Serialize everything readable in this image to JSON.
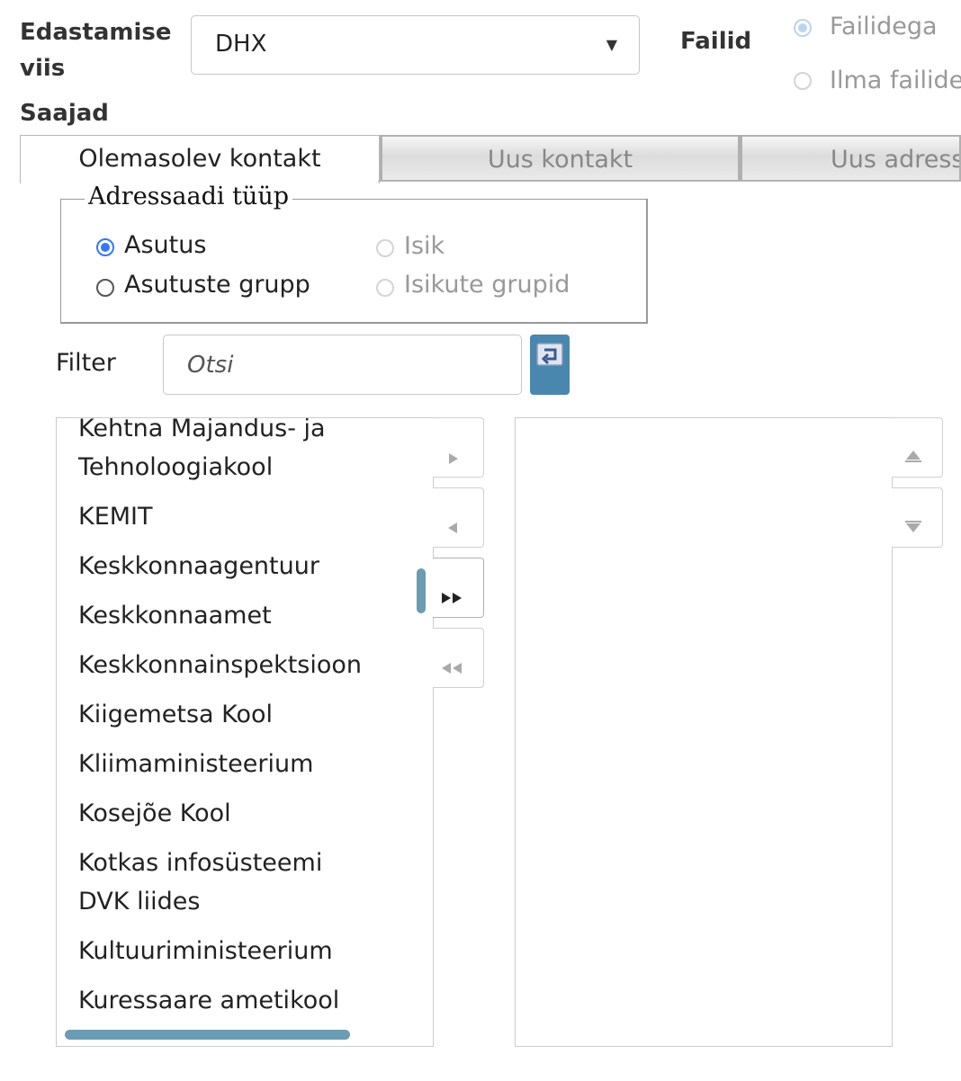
{
  "form": {
    "delivery_label_line1": "Edastamise",
    "delivery_label_line2": "viis",
    "delivery_value": "DHX",
    "files_label": "Failid",
    "file_options": [
      "Failidega",
      "Ilma failide"
    ],
    "recipients_label": "Saajad"
  },
  "tabs": [
    "Olemasolev kontakt",
    "Uus kontakt",
    "Uus adress"
  ],
  "addressee": {
    "legend": "Adressaadi tüüp",
    "options": [
      "Asutus",
      "Isik",
      "Asutuste grupp",
      "Isikute grupid"
    ]
  },
  "filter": {
    "label": "Filter",
    "placeholder": "Otsi"
  },
  "available_list": [
    {
      "lines": [
        "Kehtna Majandus- ja",
        "Tehnoloogiakool"
      ]
    },
    {
      "lines": [
        "KEMIT"
      ]
    },
    {
      "lines": [
        "Keskkonnaagentuur"
      ]
    },
    {
      "lines": [
        "Keskkonnaamet"
      ]
    },
    {
      "lines": [
        "Keskkonnainspektsioon"
      ]
    },
    {
      "lines": [
        "Kiigemetsa Kool"
      ]
    },
    {
      "lines": [
        "Kliimaministeerium"
      ]
    },
    {
      "lines": [
        "Kosejõe Kool"
      ]
    },
    {
      "lines": [
        "Kotkas infosüsteemi",
        "DVK liides"
      ]
    },
    {
      "lines": [
        "Kultuuriministeerium"
      ]
    },
    {
      "lines": [
        "Kuressaare ametikool"
      ]
    }
  ],
  "selected_list": [],
  "colors": {
    "accent": "#4a87ae",
    "scrollbar": "#6b9cb3",
    "radio_checked": "#3478f6"
  },
  "icons": {
    "reset": "undo-icon",
    "move_right": "triangle-right-icon",
    "move_left": "triangle-left-icon",
    "move_all_right": "double-triangle-right-icon",
    "move_all_left": "double-triangle-left-icon",
    "up": "triangle-up-icon",
    "down": "triangle-down-icon"
  }
}
